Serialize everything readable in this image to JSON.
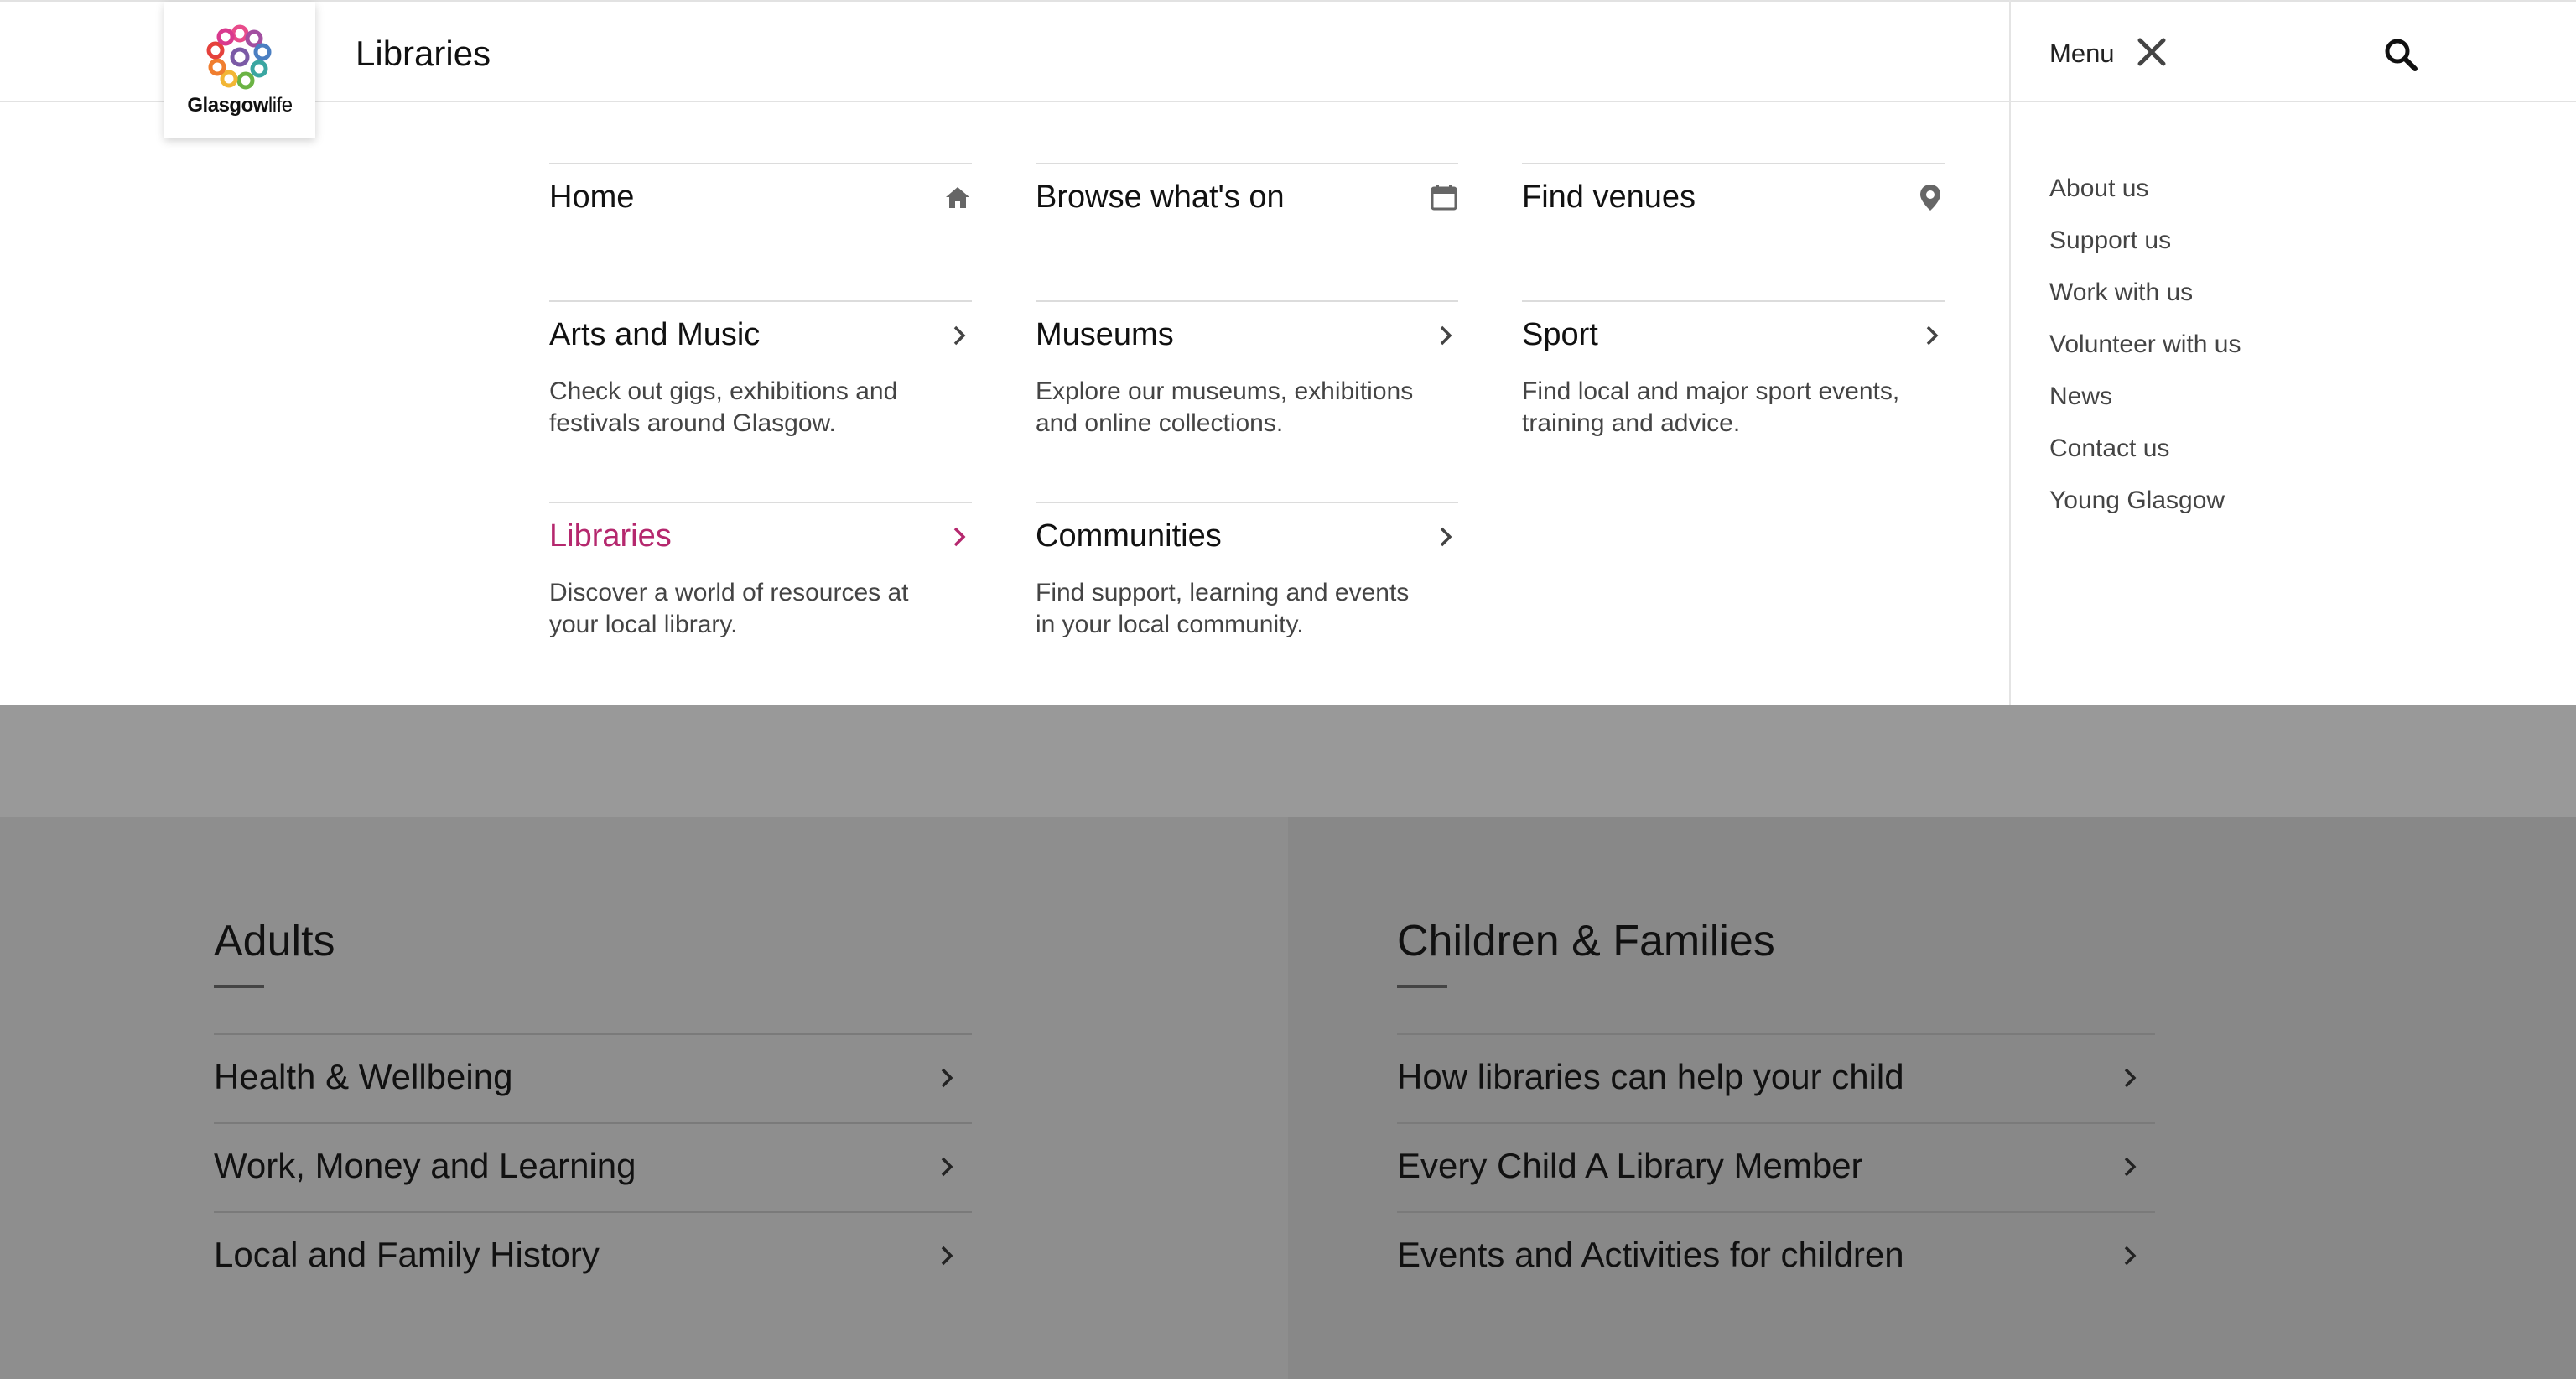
{
  "header": {
    "brand_name": "Glasgow",
    "brand_suffix": "life",
    "site_title": "Libraries",
    "menu_label": "Menu"
  },
  "mega_menu": {
    "quick_links": [
      {
        "label": "Home",
        "icon": "home-icon"
      },
      {
        "label": "Browse what's on",
        "icon": "calendar-icon"
      },
      {
        "label": "Find venues",
        "icon": "map-pin-icon"
      }
    ],
    "sections": [
      {
        "label": "Arts and Music",
        "description": "Check out gigs, exhibitions and festivals around Glasgow."
      },
      {
        "label": "Museums",
        "description": "Explore our museums, exhibitions and online collections."
      },
      {
        "label": "Sport",
        "description": "Find local and major sport events, training and advice."
      },
      {
        "label": "Libraries",
        "description": "Discover a world of resources at your local library.",
        "active": true
      },
      {
        "label": "Communities",
        "description": "Find support, learning and events in your local community."
      }
    ],
    "side_links": [
      "About us",
      "Support us",
      "Work with us",
      "Volunteer with us",
      "News",
      "Contact us",
      "Young Glasgow"
    ]
  },
  "content": {
    "adults": {
      "title": "Adults",
      "items": [
        "Health & Wellbeing",
        "Work, Money and Learning",
        "Local and Family History"
      ]
    },
    "children": {
      "title": "Children & Families",
      "items": [
        "How libraries can help your child",
        "Every Child A Library Member",
        "Events and Activities for children"
      ]
    }
  },
  "colors": {
    "accent": "#b5286e",
    "overlay_bg": "#8c8c8c"
  }
}
